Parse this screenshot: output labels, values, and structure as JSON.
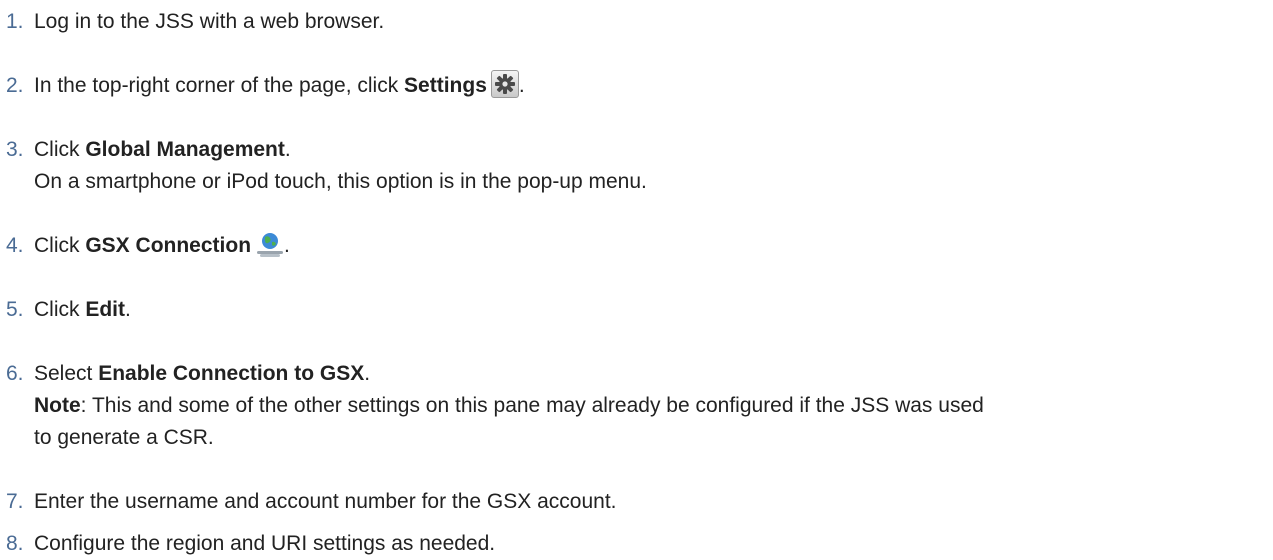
{
  "steps": [
    {
      "num": "1.",
      "parts": {
        "a": "Log in to the JSS with a web browser."
      }
    },
    {
      "num": "2.",
      "parts": {
        "a": "In the top-right corner of the page, click ",
        "b": "Settings",
        "c": "."
      }
    },
    {
      "num": "3.",
      "parts": {
        "a": "Click ",
        "b": "Global Management",
        "c": "."
      },
      "sub": "On a smartphone or iPod touch, this option is in the pop-up menu."
    },
    {
      "num": "4.",
      "parts": {
        "a": "Click ",
        "b": "GSX Connection",
        "c": "."
      }
    },
    {
      "num": "5.",
      "parts": {
        "a": "Click ",
        "b": "Edit",
        "c": "."
      }
    },
    {
      "num": "6.",
      "parts": {
        "a": "Select ",
        "b": "Enable Connection to GSX",
        "c": "."
      },
      "note": {
        "label": "Note",
        "text": ": This and some of the other settings on this pane may already be configured if the JSS was used",
        "text2": "to generate a CSR."
      }
    },
    {
      "num": "7.",
      "parts": {
        "a": "Enter the username and account number for the GSX account."
      }
    },
    {
      "num": "8.",
      "parts": {
        "a": "Configure the region and URI settings as needed."
      }
    }
  ],
  "colors": {
    "number": "#4a6b94",
    "text": "#222222"
  },
  "icons": {
    "settings": "gear-icon",
    "gsx": "globe-wrench-icon"
  }
}
